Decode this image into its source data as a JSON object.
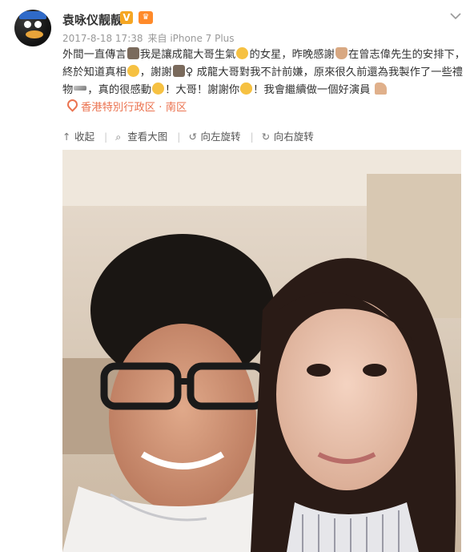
{
  "post": {
    "username": "袁咏仪靓靓",
    "verified_badge": "V",
    "level_badge": "♛",
    "date": "2017-8-18 17:38",
    "source": "来自 iPhone 7 Plus",
    "text_part1": "外間一直傳言",
    "text_part2": "我是讓成龍大哥生氣",
    "text_part3": "的女星，昨晚感謝",
    "text_part4": "在曾志偉先生的安排下，終於知道真相",
    "text_part5": "，謝謝",
    "text_part6": "♀ 成龍大哥對我不計前嫌，原來很久前還為我製作了一些禮物",
    "text_part7": "，真的很感動",
    "text_part8": "！大哥！謝謝你",
    "text_part9": "！我會繼續做一個好演員",
    "location": "香港特別行政区 · 南区"
  },
  "toolbar": {
    "collapse": "收起",
    "view_large": "查看大图",
    "rotate_left": "向左旋转",
    "rotate_right": "向右旋转"
  },
  "icons": {
    "collapse": "collapse-arrow-icon",
    "view_large": "magnifier-icon",
    "rotate_left": "rotate-left-icon",
    "rotate_right": "rotate-right-icon"
  },
  "colors": {
    "location": "#eb7350",
    "username": "#333333",
    "meta": "#999999"
  }
}
